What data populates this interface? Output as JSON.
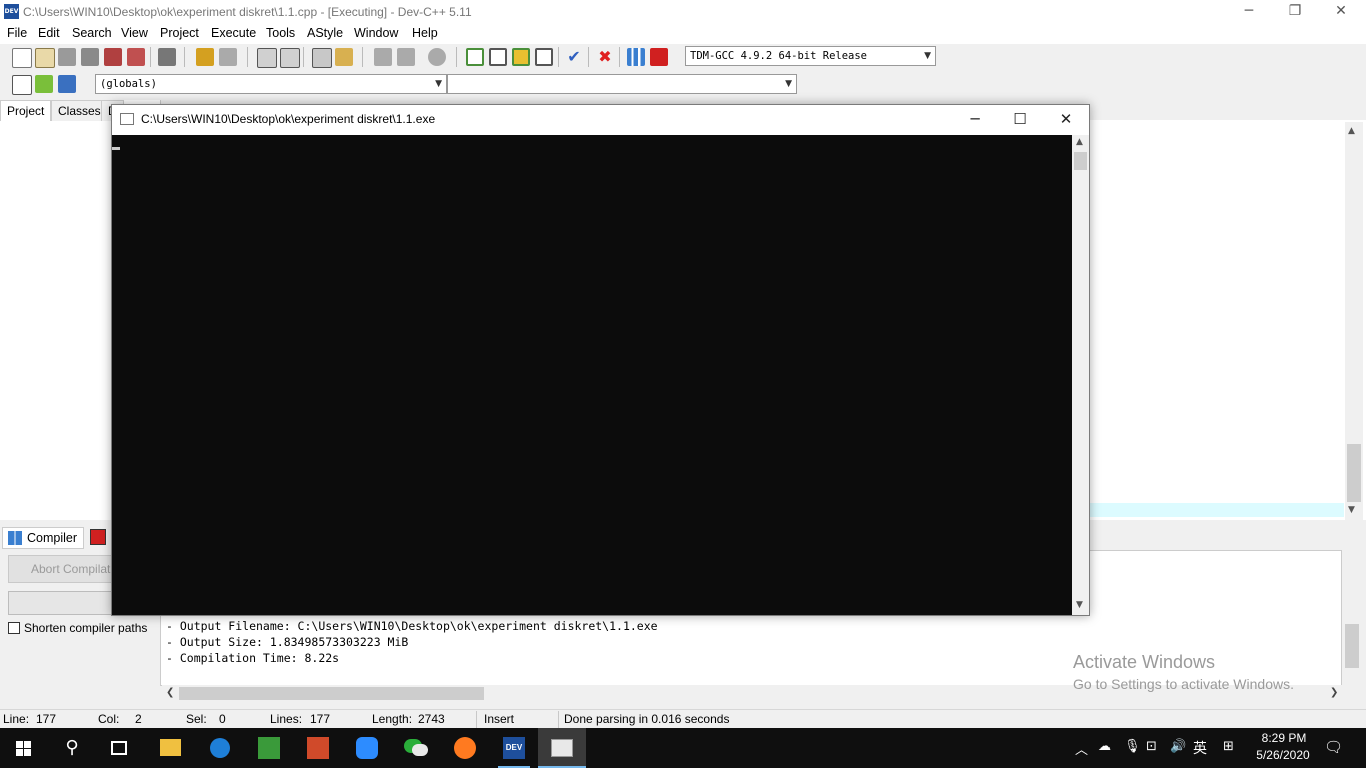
{
  "titlebar": {
    "app_icon_text": "DEV",
    "title": "C:\\Users\\WIN10\\Desktop\\ok\\experiment diskret\\1.1.cpp - [Executing] - Dev-C++ 5.11",
    "minimize": "─",
    "maximize": "❐",
    "close": "✕"
  },
  "menu": [
    "File",
    "Edit",
    "Search",
    "View",
    "Project",
    "Execute",
    "Tools",
    "AStyle",
    "Window",
    "Help"
  ],
  "toolbar": {
    "compiler_select": "TDM-GCC 4.9.2 64-bit Release",
    "scope_select": "(globals)",
    "function_select": "",
    "icons": [
      "new-file-icon",
      "open-file-icon",
      "save-icon",
      "save-all-icon",
      "close-file-icon",
      "close-all-icon",
      "print-icon",
      "undo-icon",
      "redo-icon",
      "find-icon",
      "replace-icon",
      "indent-icon",
      "unindent-icon",
      "goto-line-icon",
      "compile-icon",
      "run-icon",
      "compile-run-icon",
      "rebuild-icon",
      "syntax-check-icon",
      "stop-icon",
      "chart-icon",
      "profile-icon"
    ]
  },
  "left_panel": {
    "tabs": [
      "Project",
      "Classes",
      "D"
    ]
  },
  "bottom_panel": {
    "tab_compiler": "Compiler",
    "abort_label": "Abort Compilation",
    "shorten_label": "Shorten compiler paths",
    "shorten_checked": false,
    "log": [
      "- Output Filename: C:\\Users\\WIN10\\Desktop\\ok\\experiment diskret\\1.1.exe",
      "- Output Size: 1.83498573303223 MiB",
      "- Compilation Time: 8.22s"
    ]
  },
  "watermark": {
    "title": "Activate Windows",
    "subtitle": "Go to Settings to activate Windows."
  },
  "statusbar": {
    "line_label": "Line:",
    "line": "177",
    "col_label": "Col:",
    "col": "2",
    "sel_label": "Sel:",
    "sel": "0",
    "lines_label": "Lines:",
    "lines": "177",
    "length_label": "Length:",
    "length": "2743",
    "mode": "Insert",
    "message": "Done parsing in 0.016 seconds"
  },
  "console": {
    "title": "C:\\Users\\WIN10\\Desktop\\ok\\experiment diskret\\1.1.exe",
    "minimize": "─",
    "maximize": "☐",
    "close": "✕"
  },
  "taskbar": {
    "time": "8:29 PM",
    "date": "5/26/2020",
    "ime": "英",
    "devcpp_label": "DEV",
    "colors": {
      "accent": "#0f0f0f"
    }
  }
}
